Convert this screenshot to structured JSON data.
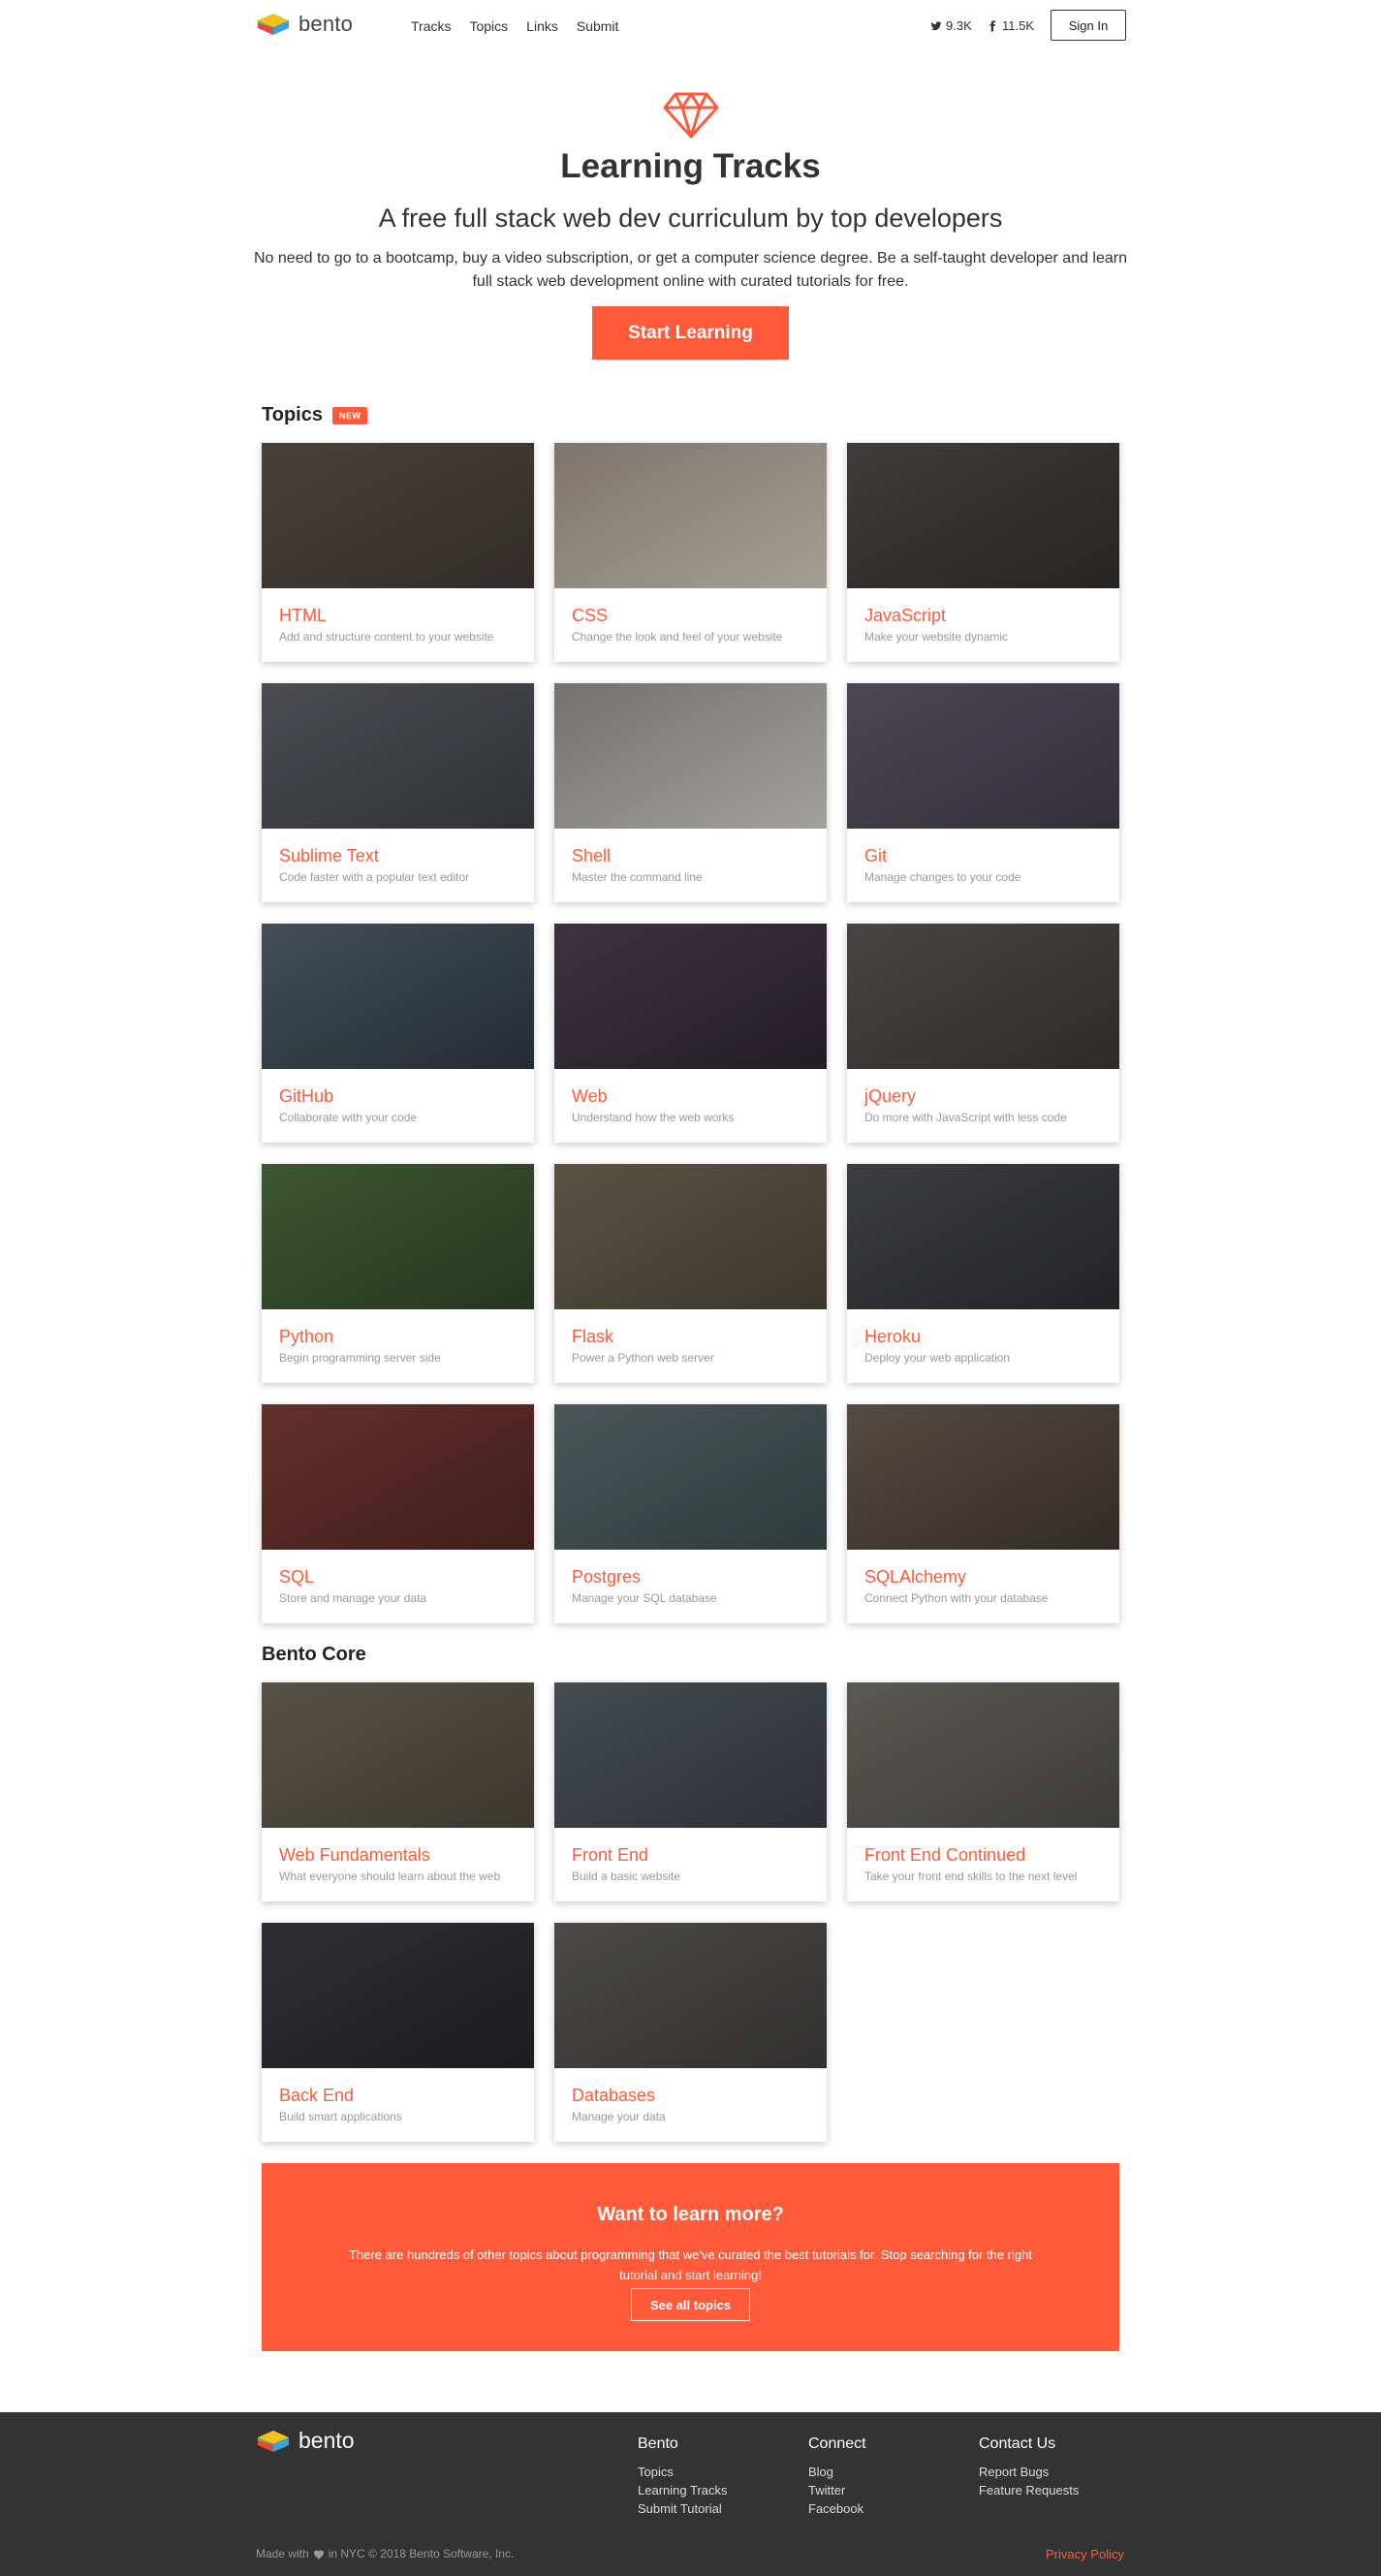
{
  "header": {
    "logo_text": "bento",
    "nav": [
      "Tracks",
      "Topics",
      "Links",
      "Submit"
    ],
    "twitter_count": "9.3K",
    "facebook_count": "11.5K",
    "signin_label": "Sign In"
  },
  "hero": {
    "title": "Learning Tracks",
    "subtitle": "A free full stack web dev curriculum by top developers",
    "description": "No need to go to a bootcamp, buy a video subscription, or get a computer science degree. Be a self-taught developer and learn full stack web development online with curated tutorials for free.",
    "cta_label": "Start Learning"
  },
  "topics": {
    "title": "Topics",
    "badge": "NEW",
    "cards": [
      {
        "title": "HTML",
        "desc": "Add and structure content to your website"
      },
      {
        "title": "CSS",
        "desc": "Change the look and feel of your website"
      },
      {
        "title": "JavaScript",
        "desc": "Make your website dynamic"
      },
      {
        "title": "Sublime Text",
        "desc": "Code faster with a popular text editor"
      },
      {
        "title": "Shell",
        "desc": "Master the command line"
      },
      {
        "title": "Git",
        "desc": "Manage changes to your code"
      },
      {
        "title": "GitHub",
        "desc": "Collaborate with your code"
      },
      {
        "title": "Web",
        "desc": "Understand how the web works"
      },
      {
        "title": "jQuery",
        "desc": "Do more with JavaScript with less code"
      },
      {
        "title": "Python",
        "desc": "Begin programming server side"
      },
      {
        "title": "Flask",
        "desc": "Power a Python web server"
      },
      {
        "title": "Heroku",
        "desc": "Deploy your web application"
      },
      {
        "title": "SQL",
        "desc": "Store and manage your data"
      },
      {
        "title": "Postgres",
        "desc": "Manage your SQL database"
      },
      {
        "title": "SQLAlchemy",
        "desc": "Connect Python with your database"
      }
    ]
  },
  "core": {
    "title": "Bento Core",
    "cards": [
      {
        "title": "Web Fundamentals",
        "desc": "What everyone should learn about the web"
      },
      {
        "title": "Front End",
        "desc": "Build a basic website"
      },
      {
        "title": "Front End Continued",
        "desc": "Take your front end skills to the next level"
      },
      {
        "title": "Back End",
        "desc": "Build smart applications"
      },
      {
        "title": "Databases",
        "desc": "Manage your data"
      }
    ]
  },
  "learn_more": {
    "title": "Want to learn more?",
    "description": "There are hundreds of other topics about programming that we've curated the best tutorials for. Stop searching for the right tutorial and start learning!",
    "button_label": "See all topics"
  },
  "footer": {
    "logo_text": "bento",
    "columns": [
      {
        "title": "Bento",
        "links": [
          "Topics",
          "Learning Tracks",
          "Submit Tutorial"
        ]
      },
      {
        "title": "Connect",
        "links": [
          "Blog",
          "Twitter",
          "Facebook"
        ]
      },
      {
        "title": "Contact Us",
        "links": [
          "Report Bugs",
          "Feature Requests"
        ]
      }
    ],
    "made_with": "Made with",
    "made_in": "in NYC © 2018 Bento Software, Inc.",
    "privacy": "Privacy Policy"
  },
  "colors": {
    "accent": "#ff5b3a",
    "footer_bg": "#333333",
    "text": "#333333",
    "muted": "#999999"
  }
}
